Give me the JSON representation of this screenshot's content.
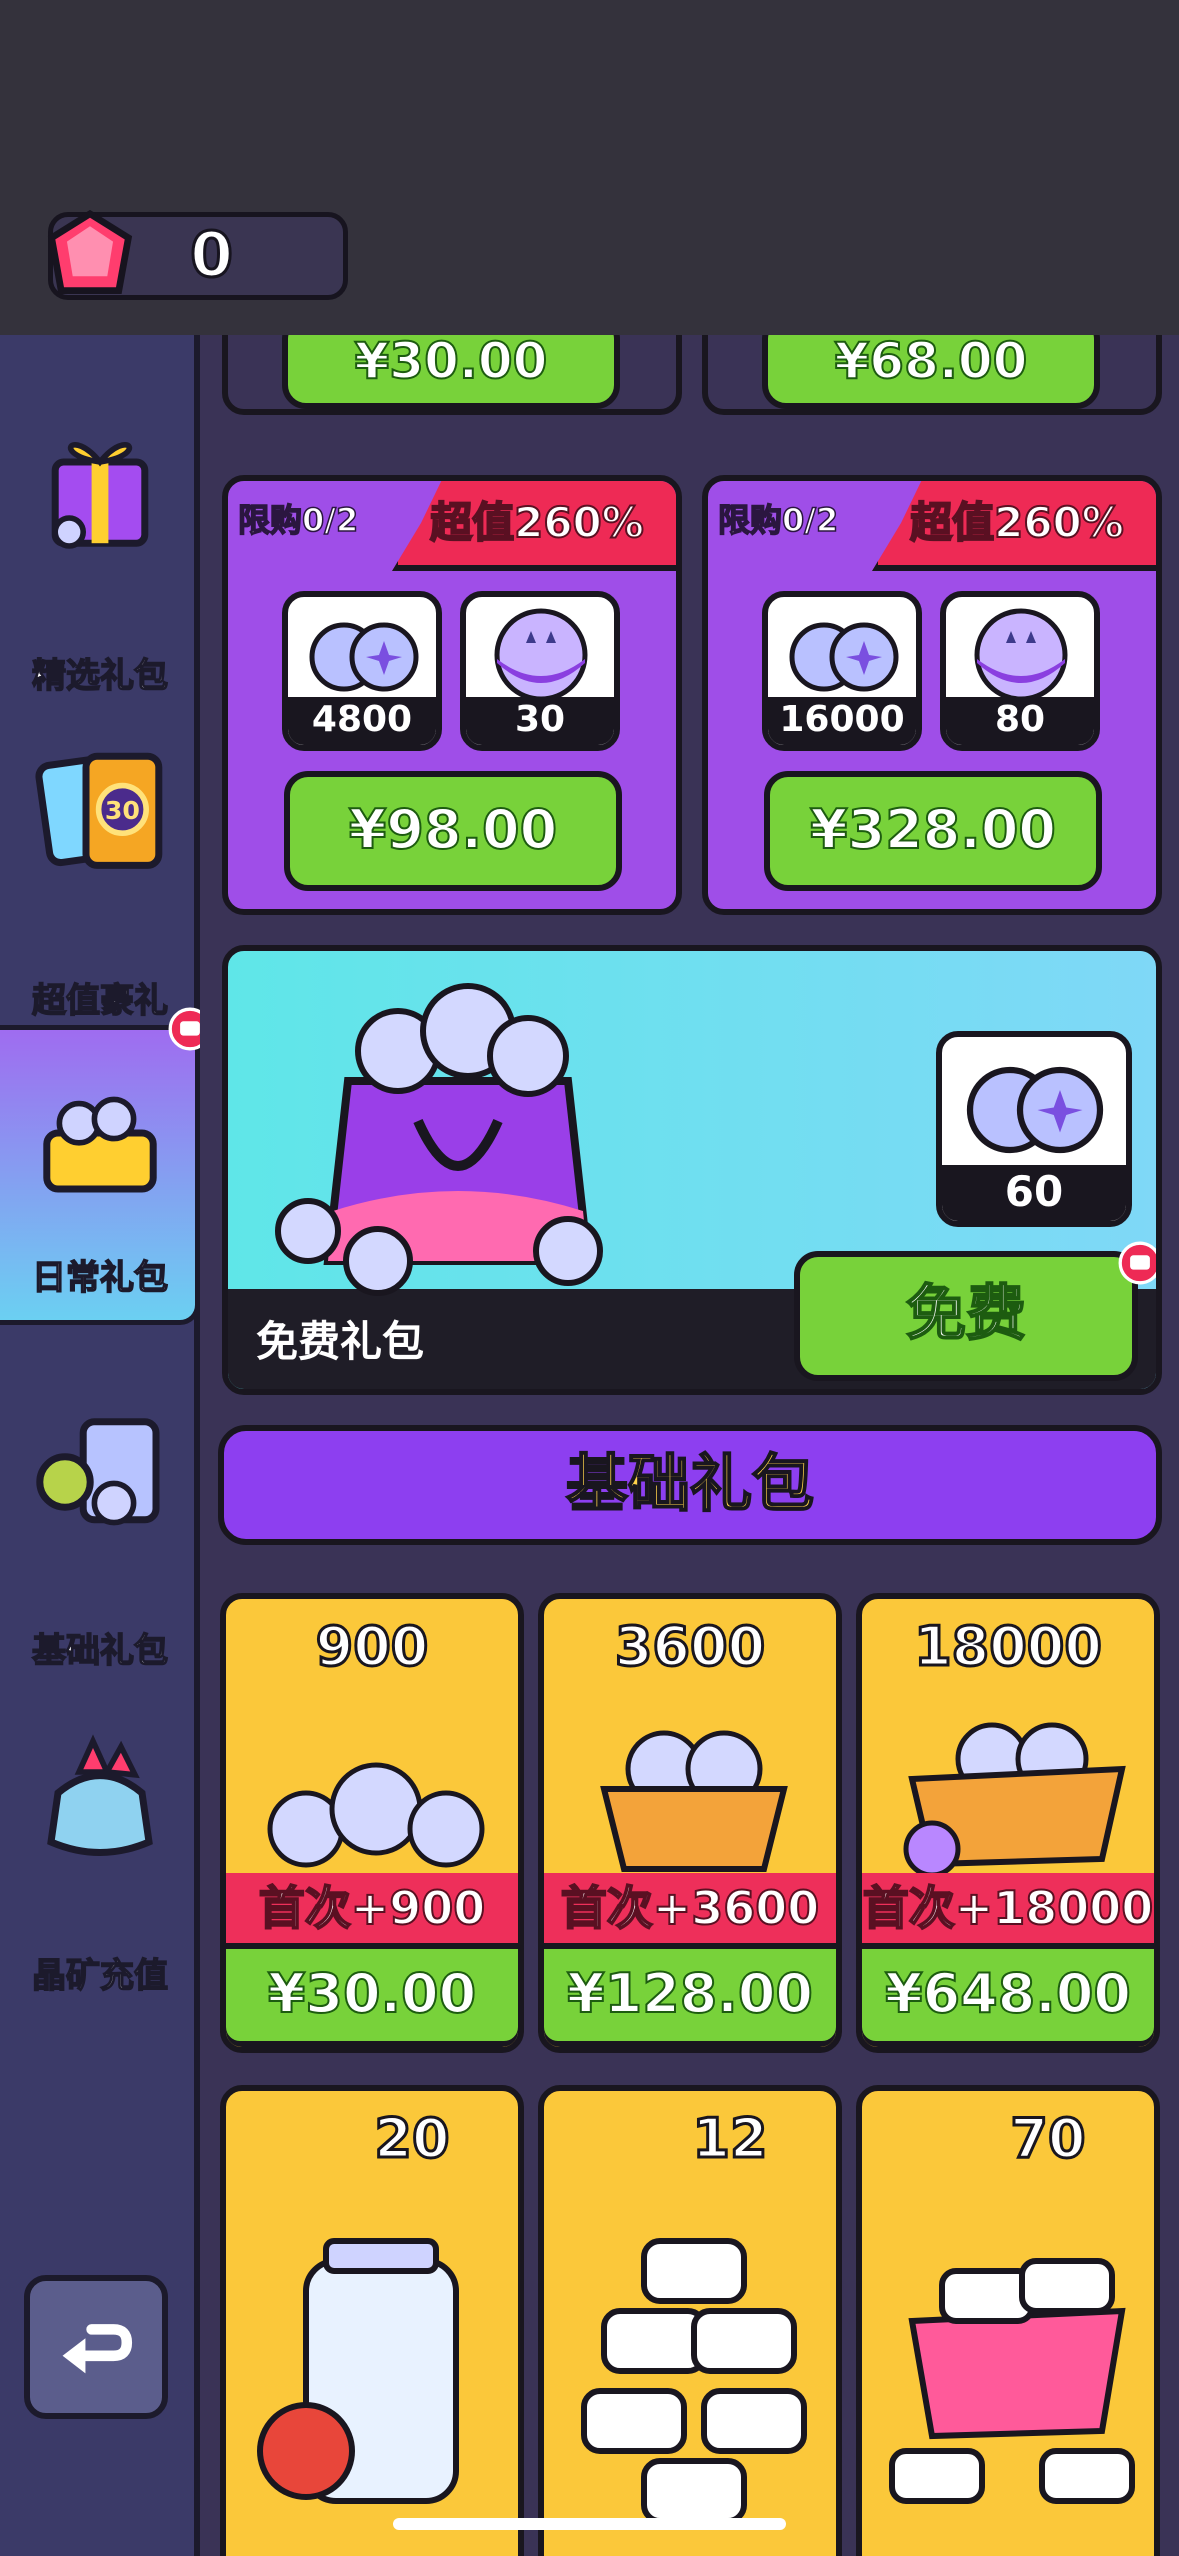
{
  "currency": {
    "gems": "0"
  },
  "sidebar": {
    "items": [
      {
        "label": "精选礼包",
        "icon": "gift-box-icon"
      },
      {
        "label": "超值豪礼",
        "icon": "cards-icon"
      },
      {
        "label": "日常礼包",
        "icon": "daily-basket-icon"
      },
      {
        "label": "基础礼包",
        "icon": "basic-pack-icon"
      },
      {
        "label": "晶矿充值",
        "icon": "crystal-pouch-icon"
      }
    ],
    "badge_count": "30",
    "back_icon": "back-arrow-icon"
  },
  "top_prices": [
    "¥30.00",
    "¥68.00"
  ],
  "value_packs": [
    {
      "limit": "限购0/2",
      "ribbon": "超值260%",
      "items": [
        {
          "count": "4800"
        },
        {
          "count": "30"
        }
      ],
      "price": "¥98.00"
    },
    {
      "limit": "限购0/2",
      "ribbon": "超值260%",
      "items": [
        {
          "count": "16000"
        },
        {
          "count": "80"
        }
      ],
      "price": "¥328.00"
    }
  ],
  "free_pack": {
    "title": "免费礼包",
    "item_count": "60",
    "button": "免费"
  },
  "section_title": "基础礼包",
  "basic_packs": [
    {
      "amount": "900",
      "first": "首次+900",
      "price": "¥30.00"
    },
    {
      "amount": "3600",
      "first": "首次+3600",
      "price": "¥128.00"
    },
    {
      "amount": "18000",
      "first": "首次+18000",
      "price": "¥648.00"
    }
  ],
  "item_packs": [
    {
      "amount": "20",
      "icon": "capsule-icon"
    },
    {
      "amount": "12",
      "icon": "lunchbox-icon"
    },
    {
      "amount": "70",
      "icon": "lunchbox-icon"
    }
  ],
  "colors": {
    "accent_green": "#78d23a",
    "ribbon_red": "#ee2a55",
    "purple": "#9f4ee8",
    "yellow": "#fbc83a"
  }
}
